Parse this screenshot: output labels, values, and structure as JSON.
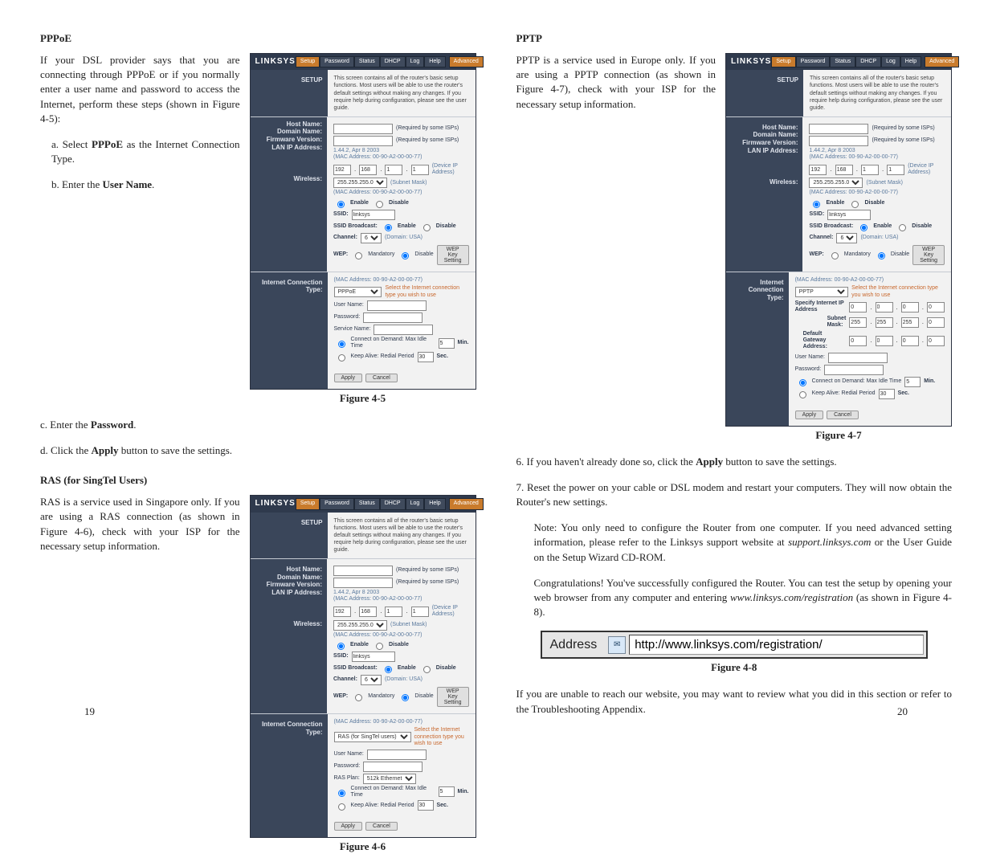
{
  "left": {
    "pppoe": {
      "heading": "PPPoE",
      "intro": "If your DSL provider says that you are connecting through PPPoE or if you normally enter a user name and password to access the Internet, perform these steps (shown in Figure 4-5):",
      "step_a_pre": "a. Select ",
      "step_a_bold": "PPPoE",
      "step_a_post": " as the Internet Connection Type.",
      "step_b_pre": "b. Enter the ",
      "step_b_bold": "User Name",
      "step_b_post": ".",
      "step_c_pre": "c. Enter the ",
      "step_c_bold": "Password",
      "step_c_post": ".",
      "step_d_pre": "d. Click the ",
      "step_d_bold": "Apply",
      "step_d_post": " button to save the settings.",
      "fig_caption": "Figure 4-5"
    },
    "ras": {
      "heading": "RAS (for SingTel Users)",
      "intro": "RAS is a service used in Singapore only. If you are using a RAS connection (as shown in Figure 4-6), check with your ISP for the necessary setup information.",
      "fig_caption": "Figure 4-6"
    },
    "page_number": "19"
  },
  "right": {
    "pptp": {
      "heading": "PPTP",
      "intro": "PPTP is a service used in Europe only. If you are using a PPTP connection (as shown in Figure 4-7), check with your ISP for the necessary setup information.",
      "fig_caption": "Figure 4-7"
    },
    "step6_pre": "6.  If you haven't already done so, click the ",
    "step6_bold": "Apply",
    "step6_post": " button to save the settings.",
    "step7": "7.  Reset the power on your cable or DSL modem and restart your computers. They will now obtain the Router's new settings.",
    "note_pre": "Note: You only need to configure the Router from one computer. If you need advanced setting information, please refer to the Linksys support website at ",
    "note_em": "support.linksys.com",
    "note_post": " or the User Guide on the Setup Wizard CD-ROM.",
    "congrats_pre": "Congratulations! You've successfully configured the Router. You can test the setup by opening your web browser from any computer and entering ",
    "congrats_em": "www.linksys.com/registration",
    "congrats_post": " (as shown in Figure 4-8).",
    "addr_label": "Address",
    "addr_url": "http://www.linksys.com/registration/",
    "fig8_caption": "Figure 4-8",
    "closing": "If you are unable to reach our website, you may want to review what you did in this section or refer to the Troubleshooting Appendix.",
    "page_number": "20"
  },
  "router": {
    "logo": "LINKSYS",
    "tabs": {
      "setup": "Setup",
      "password": "Password",
      "status": "Status",
      "dhcp": "DHCP",
      "log": "Log",
      "help": "Help",
      "advanced": "Advanced"
    },
    "side_setup": "SETUP",
    "intro_text": "This screen contains all of the router's basic setup functions. Most users will be able to use the router's default settings without making any changes. If you require help during configuration, please see the user guide.",
    "host_name": "Host Name:",
    "domain_name": "Domain Name:",
    "required_hint": "(Required by some ISPs)",
    "firmware": "Firmware Version:",
    "firmware_val": "1.44.2, Apr 8 2003",
    "lan_ip": "LAN IP Address:",
    "mac_prefix": "(MAC Address: 00-90-A2-00-00-77)",
    "oct1": "192",
    "oct2": "168",
    "oct3": "1",
    "oct4": "1",
    "device_ip": "(Device IP Address)",
    "subnet": "255.255.255.0",
    "subnet_hint": "(Subnet Mask)",
    "wireless": "Wireless:",
    "en_dis_enable": "Enable",
    "en_dis_disable": "Disable",
    "ssid_label": "SSID:",
    "ssid_val": "linksys",
    "ssid_bcast": "SSID Broadcast:",
    "channel_label": "Channel:",
    "channel_val": "6",
    "channel_hint": "(Domain: USA)",
    "wep_label": "WEP:",
    "wep_mand": "Mandatory",
    "wep_dis": "Disable",
    "wep_btn": "WEP Key Setting",
    "ict": "Internet Connection Type:",
    "select_hint": "Select the Internet connection type you wish to use",
    "user_name": "User Name:",
    "password": "Password:",
    "service_name": "Service Name:",
    "cod": "Connect on Demand: Max Idle Time",
    "cod_val": "5",
    "cod_min": "Min.",
    "ka": "Keep Alive: Redial Period",
    "ka_val": "30",
    "ka_sec": "Sec.",
    "apply": "Apply",
    "cancel": "Cancel",
    "conn_pppoe": "PPPoE",
    "conn_ras": "RAS (for SingTel users)",
    "conn_pptp": "PPTP",
    "ras_plan_label": "RAS Plan:",
    "ras_plan_val": "512k Ethernet",
    "pptp_specify": "Specify Internet IP Address",
    "pptp_mask": "Subnet Mask:",
    "pptp_gw": "Default Gateway Address:",
    "m255": "255",
    "m0": "0"
  }
}
